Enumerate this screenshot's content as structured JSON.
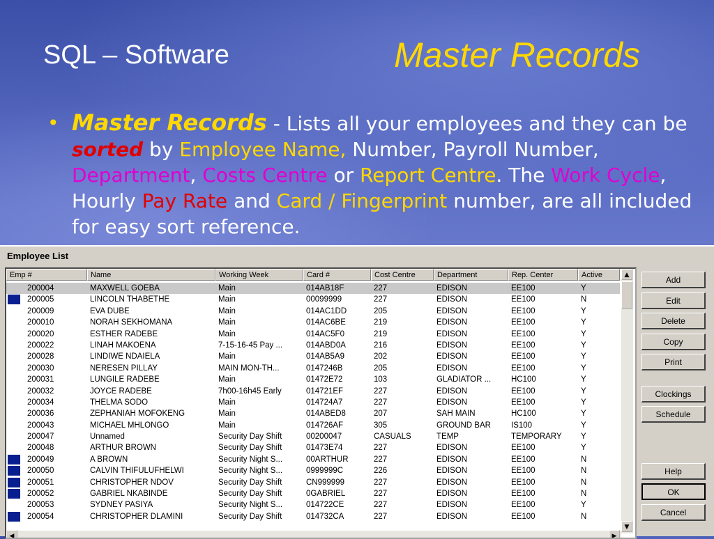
{
  "slide": {
    "title": "SQL – Software",
    "title_right": "Master Records",
    "bullet": {
      "term": "Master Records",
      "dash": " - ",
      "t1": "Lists all your employees and they can be ",
      "sorted": "sorted",
      "t2": " by ",
      "emp_name": "Employee Name,",
      "t3": " Number, Payroll Number, ",
      "dept": "Department",
      "t4": ", ",
      "costs": "Costs Centre",
      "t5": " or ",
      "report": "Report Centre",
      "t6": ".   The ",
      "work": "Work Cycle",
      "t7": ", Hourly ",
      "pay": "Pay Rate",
      "t8": " and ",
      "card": "Card / Fingerprint",
      "t9": " number, are all included for easy sort reference."
    }
  },
  "window": {
    "title": "Employee List",
    "columns": [
      "Emp #",
      "Name",
      "Working Week",
      "Card #",
      "Cost Centre",
      "Department",
      "Rep. Center",
      "Active"
    ],
    "rows": [
      {
        "emp": "200004",
        "name": "MAXWELL GOEBA",
        "week": "Main",
        "card": "014AB18F",
        "cost": "227",
        "dept": "EDISON",
        "rep": "EE100",
        "active": "Y",
        "selected": true,
        "marker": false
      },
      {
        "emp": "200005",
        "name": "LINCOLN THABETHE",
        "week": "Main",
        "card": "00099999",
        "cost": "227",
        "dept": "EDISON",
        "rep": "EE100",
        "active": "N",
        "marker": true
      },
      {
        "emp": "200009",
        "name": "EVA DUBE",
        "week": "Main",
        "card": "014AC1DD",
        "cost": "205",
        "dept": "EDISON",
        "rep": "EE100",
        "active": "Y",
        "marker": false
      },
      {
        "emp": "200010",
        "name": "NORAH SEKHOMANA",
        "week": "Main",
        "card": "014AC6BE",
        "cost": "219",
        "dept": "EDISON",
        "rep": "EE100",
        "active": "Y",
        "marker": false
      },
      {
        "emp": "200020",
        "name": "ESTHER RADEBE",
        "week": "Main",
        "card": "014AC5F0",
        "cost": "219",
        "dept": "EDISON",
        "rep": "EE100",
        "active": "Y",
        "marker": false
      },
      {
        "emp": "200022",
        "name": "LINAH MAKOENA",
        "week": "7-15-16-45 Pay ...",
        "card": "014ABD0A",
        "cost": "216",
        "dept": "EDISON",
        "rep": "EE100",
        "active": "Y",
        "marker": false
      },
      {
        "emp": "200028",
        "name": "LINDIWE NDAIELA",
        "week": "Main",
        "card": "014AB5A9",
        "cost": "202",
        "dept": "EDISON",
        "rep": "EE100",
        "active": "Y",
        "marker": false
      },
      {
        "emp": "200030",
        "name": "NERESEN PILLAY",
        "week": "MAIN MON-TH...",
        "card": "0147246B",
        "cost": "205",
        "dept": "EDISON",
        "rep": "EE100",
        "active": "Y",
        "marker": false
      },
      {
        "emp": "200031",
        "name": "LUNGILE RADEBE",
        "week": "Main",
        "card": "01472E72",
        "cost": "103",
        "dept": "GLADIATOR ...",
        "rep": "HC100",
        "active": "Y",
        "marker": false
      },
      {
        "emp": "200032",
        "name": "JOYCE RADEBE",
        "week": "7h00-16h45 Early",
        "card": "014721EF",
        "cost": "227",
        "dept": "EDISON",
        "rep": "EE100",
        "active": "Y",
        "marker": false
      },
      {
        "emp": "200034",
        "name": "THELMA SODO",
        "week": "Main",
        "card": "014724A7",
        "cost": "227",
        "dept": "EDISON",
        "rep": "EE100",
        "active": "Y",
        "marker": false
      },
      {
        "emp": "200036",
        "name": "ZEPHANIAH MOFOKENG",
        "week": "Main",
        "card": "014ABED8",
        "cost": "207",
        "dept": "SAH MAIN",
        "rep": "HC100",
        "active": "Y",
        "marker": false
      },
      {
        "emp": "200043",
        "name": "MICHAEL MHLONGO",
        "week": "Main",
        "card": "014726AF",
        "cost": "305",
        "dept": "GROUND BAR",
        "rep": "IS100",
        "active": "Y",
        "marker": false
      },
      {
        "emp": "200047",
        "name": "Unnamed",
        "week": "Security Day Shift",
        "card": "00200047",
        "cost": "CASUALS",
        "dept": "TEMP",
        "rep": "TEMPORARY",
        "active": "Y",
        "marker": false
      },
      {
        "emp": "200048",
        "name": "ARTHUR BROWN",
        "week": "Security Day Shift",
        "card": "01473E74",
        "cost": "227",
        "dept": "EDISON",
        "rep": "EE100",
        "active": "Y",
        "marker": false
      },
      {
        "emp": "200049",
        "name": "A BROWN",
        "week": "Security Night S...",
        "card": "00ARTHUR",
        "cost": "227",
        "dept": "EDISON",
        "rep": "EE100",
        "active": "N",
        "marker": true
      },
      {
        "emp": "200050",
        "name": "CALVIN THIFULUFHELWI",
        "week": "Security Night S...",
        "card": "0999999C",
        "cost": "226",
        "dept": "EDISON",
        "rep": "EE100",
        "active": "N",
        "marker": true
      },
      {
        "emp": "200051",
        "name": "CHRISTOPHER NDOV",
        "week": "Security Day Shift",
        "card": "CN999999",
        "cost": "227",
        "dept": "EDISON",
        "rep": "EE100",
        "active": "N",
        "marker": true
      },
      {
        "emp": "200052",
        "name": "GABRIEL NKABINDE",
        "week": "Security Day Shift",
        "card": "0GABRIEL",
        "cost": "227",
        "dept": "EDISON",
        "rep": "EE100",
        "active": "N",
        "marker": true
      },
      {
        "emp": "200053",
        "name": "SYDNEY PASIYA",
        "week": "Security Night S...",
        "card": "014722CE",
        "cost": "227",
        "dept": "EDISON",
        "rep": "EE100",
        "active": "Y",
        "marker": false
      },
      {
        "emp": "200054",
        "name": "CHRISTOPHER DLAMINI",
        "week": "Security Day Shift",
        "card": "014732CA",
        "cost": "227",
        "dept": "EDISON",
        "rep": "EE100",
        "active": "N",
        "marker": true
      }
    ],
    "buttons": {
      "add": "Add",
      "edit": "Edit",
      "delete": "Delete",
      "copy": "Copy",
      "print": "Print",
      "clockings": "Clockings",
      "schedule": "Schedule",
      "help": "Help",
      "ok": "OK",
      "cancel": "Cancel"
    },
    "inactive_marker_color": "#0a1f8f"
  }
}
